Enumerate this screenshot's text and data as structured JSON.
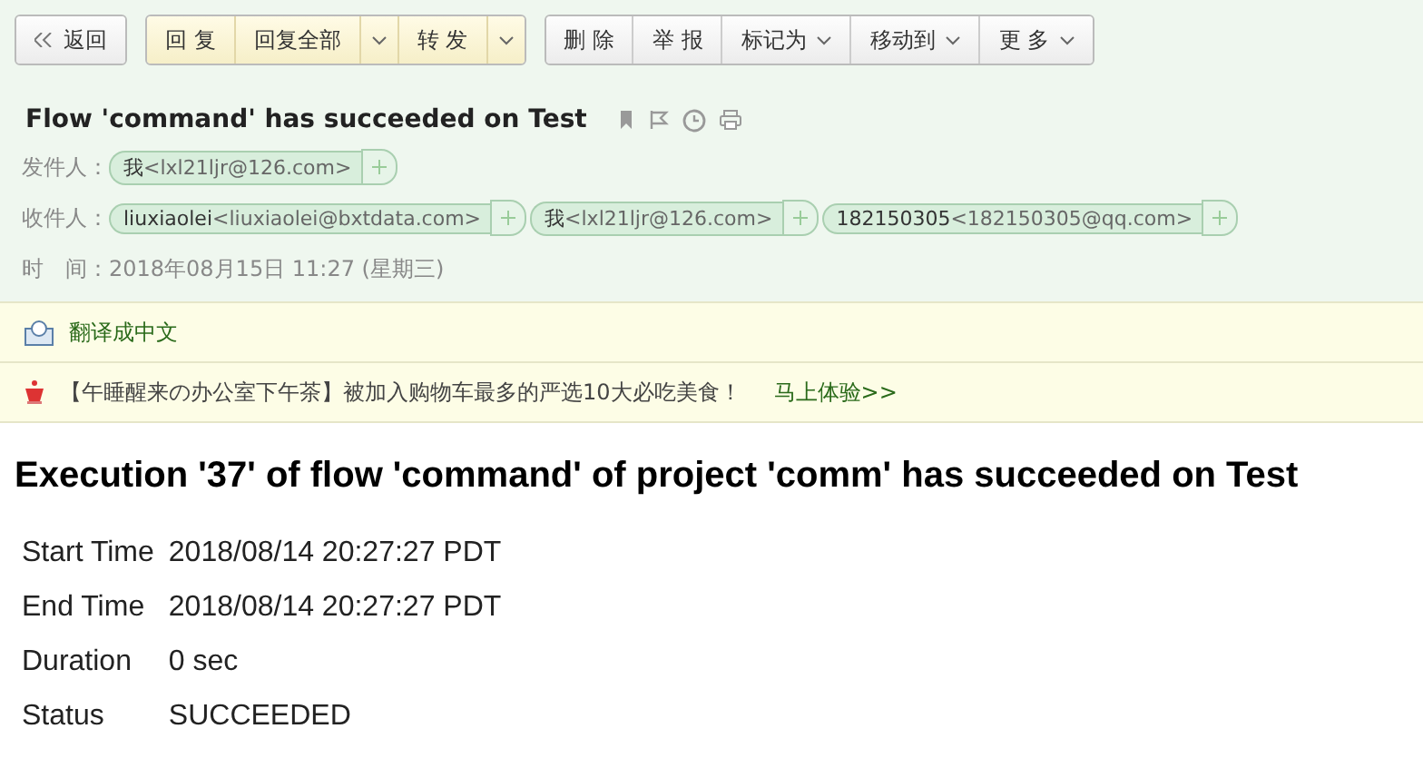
{
  "toolbar": {
    "groups": [
      {
        "highlighted": false,
        "buttons": [
          {
            "kind": "back",
            "label": "返回"
          }
        ]
      },
      {
        "highlighted": true,
        "buttons": [
          {
            "kind": "button",
            "label": "回 复"
          },
          {
            "kind": "button",
            "label": "回复全部"
          },
          {
            "kind": "caret"
          },
          {
            "kind": "button",
            "label": "转 发"
          },
          {
            "kind": "caret"
          }
        ]
      },
      {
        "highlighted": false,
        "buttons": [
          {
            "kind": "button",
            "label": "删 除"
          },
          {
            "kind": "button",
            "label": "举 报"
          },
          {
            "kind": "menu",
            "label": "标记为"
          },
          {
            "kind": "menu",
            "label": "移动到"
          },
          {
            "kind": "menu",
            "label": "更 多"
          }
        ]
      }
    ]
  },
  "subject": "Flow 'command' has succeeded on Test",
  "sender": {
    "label": "发件人：",
    "contacts": [
      {
        "name": "我",
        "address": "<lxl21ljr@126.com>"
      }
    ]
  },
  "recipients": {
    "label": "收件人：",
    "contacts": [
      {
        "name": "liuxiaolei",
        "address": "<liuxiaolei@bxtdata.com>"
      },
      {
        "name": "我",
        "address": "<lxl21ljr@126.com>"
      },
      {
        "name": "182150305",
        "address": "<182150305@qq.com>"
      }
    ]
  },
  "time": {
    "label": "时　间：",
    "value": "2018年08月15日 11:27 (星期三)"
  },
  "translate": "翻译成中文",
  "promo": {
    "text": "【午睡醒来の办公室下午茶】被加入购物车最多的严选10大必吃美食！",
    "link": "马上体验>>"
  },
  "body": {
    "heading": "Execution '37' of flow 'command' of project 'comm' has succeeded on Test",
    "fields": [
      {
        "label": "Start Time",
        "value": "2018/08/14 20:27:27 PDT"
      },
      {
        "label": "End Time",
        "value": "2018/08/14 20:27:27 PDT"
      },
      {
        "label": "Duration",
        "value": "0 sec"
      },
      {
        "label": "Status",
        "value": "SUCCEEDED"
      }
    ]
  }
}
